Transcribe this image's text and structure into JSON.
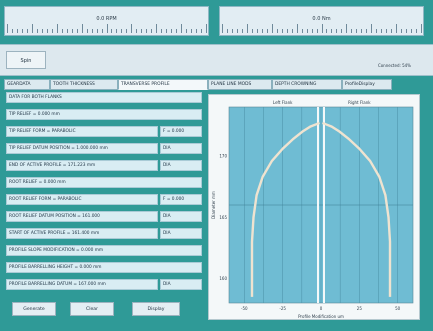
{
  "gauges": [
    {
      "label": "0.0 RPM"
    },
    {
      "label": "0.0 Nm"
    }
  ],
  "toolbar": {
    "button_label": "Spin",
    "status_text": "Connected: 54%"
  },
  "tabs": [
    {
      "label": "GEARDATA"
    },
    {
      "label": "TOOTH THICKNESS"
    },
    {
      "label": "TRANSVERSE PROFILE"
    },
    {
      "label": "PLANE LINE MODS"
    },
    {
      "label": "DEPTH CROWNING"
    },
    {
      "label": "ProfileDisplay"
    }
  ],
  "rows": [
    {
      "label": "DATA FOR BOTH FLANKS",
      "value": ""
    },
    {
      "label": "TIP RELIEF = 0.000 mm",
      "value": ""
    },
    {
      "label": "TIP RELIEF FORM = PARABOLIC",
      "value": "F = 0.000"
    },
    {
      "label": "TIP RELIEF DATUM POSITION = 1.000.000 mm",
      "value": "DIA"
    },
    {
      "label": "END OF ACTIVE PROFILE = 171.223 mm",
      "value": "DIA"
    },
    {
      "label": "ROOT RELIEF = 0.000 mm",
      "value": ""
    },
    {
      "label": "ROOT RELIEF FORM = PARABOLIC",
      "value": "F = 0.000"
    },
    {
      "label": "ROOT RELIEF DATUM POSITION = 161.000",
      "value": "DIA"
    },
    {
      "label": "START OF ACTIVE PROFILE = 161.400 mm",
      "value": "DIA"
    },
    {
      "label": "PROFILE SLOPE MODIFICATION = 0.000 mm",
      "value": ""
    },
    {
      "label": "PROFILE BARRELLING HEIGHT = 0.000 mm",
      "value": ""
    },
    {
      "label": "PROFILE BARRELLING DATUM = 167.000 mm",
      "value": "DIA"
    }
  ],
  "buttons": {
    "generate": "Generate",
    "clear": "Clear",
    "display": "Display"
  },
  "chart_data": {
    "type": "line",
    "title_left": "Left Flank",
    "title_right": "Right Flank",
    "ylabel": "Diameter mm",
    "xlabel": "Profile Modification um",
    "xlim": [
      -60,
      60
    ],
    "ylim": [
      158,
      174
    ],
    "x_ticks": [
      "-50",
      "-25",
      "0",
      "25",
      "50"
    ],
    "y_ticks": [
      "160",
      "165",
      "170"
    ],
    "series": [
      {
        "name": "Left Flank",
        "x": [
          -45,
          -45,
          -44,
          -42,
          -38,
          -32,
          -25,
          -18,
          -12,
          -7,
          -3,
          -1
        ],
        "y": [
          158.5,
          163,
          165,
          166.8,
          168.3,
          169.6,
          170.6,
          171.4,
          172,
          172.4,
          172.6,
          172.7
        ]
      },
      {
        "name": "Right Flank",
        "x": [
          45,
          45,
          44,
          42,
          38,
          32,
          25,
          18,
          12,
          7,
          3,
          1
        ],
        "y": [
          158.5,
          163,
          165,
          166.8,
          168.3,
          169.6,
          170.6,
          171.4,
          172,
          172.4,
          172.6,
          172.7
        ]
      }
    ]
  }
}
